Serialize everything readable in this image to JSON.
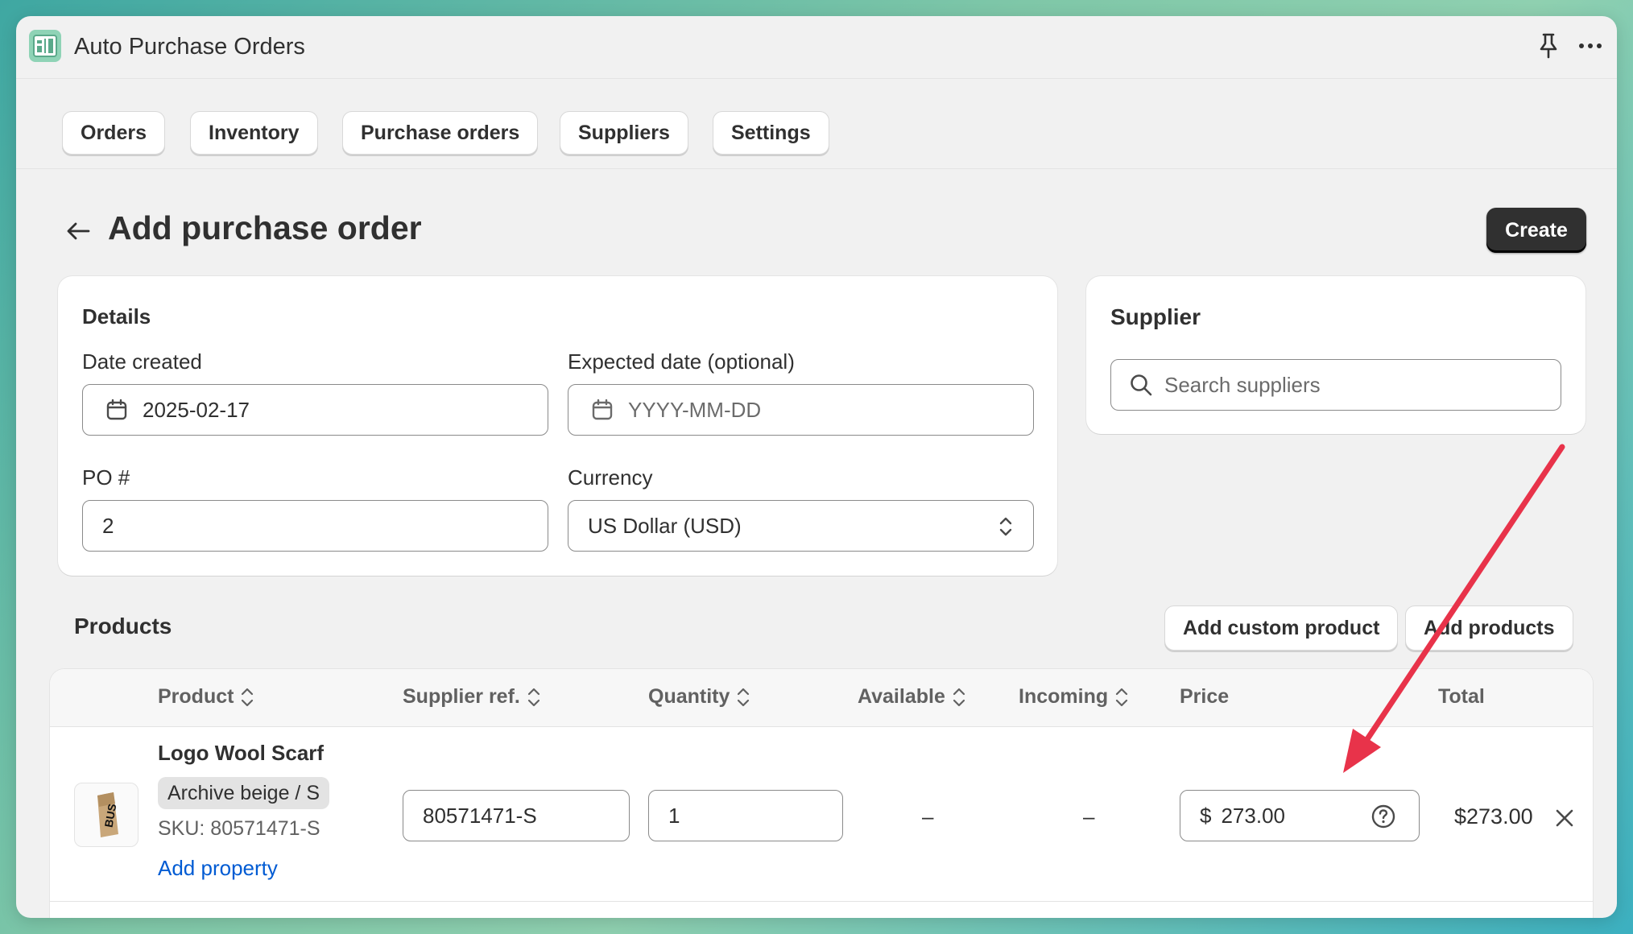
{
  "app": {
    "title": "Auto Purchase Orders"
  },
  "nav": {
    "tabs": [
      {
        "label": "Orders"
      },
      {
        "label": "Inventory"
      },
      {
        "label": "Purchase orders"
      },
      {
        "label": "Suppliers"
      },
      {
        "label": "Settings"
      }
    ]
  },
  "page": {
    "title": "Add purchase order",
    "create_label": "Create"
  },
  "details": {
    "title": "Details",
    "date_created_label": "Date created",
    "date_created_value": "2025-02-17",
    "expected_date_label": "Expected date (optional)",
    "expected_date_placeholder": "YYYY-MM-DD",
    "po_label": "PO #",
    "po_value": "2",
    "currency_label": "Currency",
    "currency_value": "US Dollar (USD)"
  },
  "supplier": {
    "title": "Supplier",
    "search_placeholder": "Search suppliers"
  },
  "products": {
    "title": "Products",
    "add_custom_label": "Add custom product",
    "add_products_label": "Add products",
    "columns": {
      "product": "Product",
      "supplier_ref": "Supplier ref.",
      "quantity": "Quantity",
      "available": "Available",
      "incoming": "Incoming",
      "price": "Price",
      "total": "Total"
    },
    "rows": [
      {
        "name": "Logo Wool Scarf",
        "variant": "Archive beige / S",
        "sku": "SKU: 80571471-S",
        "add_property": "Add property",
        "supplier_ref": "80571471-S",
        "quantity": "1",
        "available": "–",
        "incoming": "–",
        "currency_symbol": "$",
        "price": "273.00",
        "total": "$273.00"
      }
    ]
  },
  "colors": {
    "accent": "#303030",
    "link": "#005bd3",
    "annotation_arrow": "#e8334a"
  }
}
